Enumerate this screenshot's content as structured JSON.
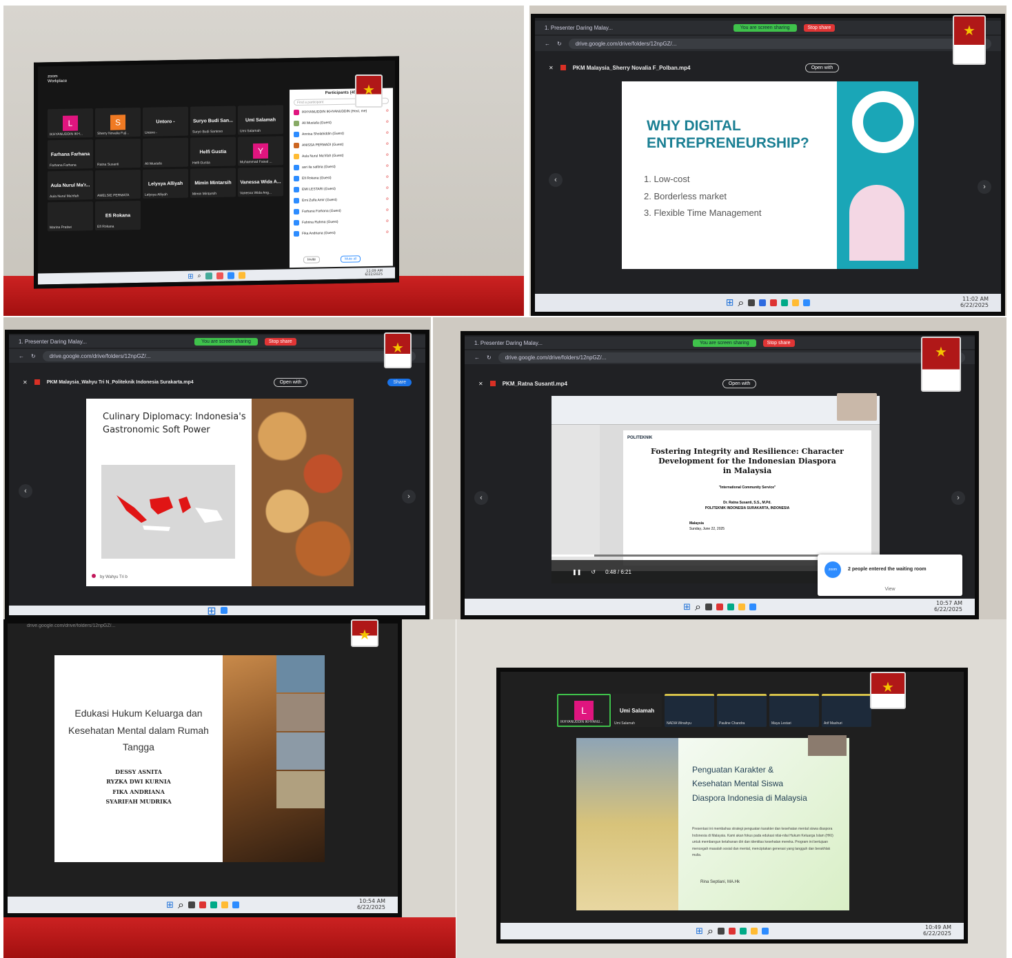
{
  "photo1": {
    "app_label": "zoom\nWorkplace",
    "participants_header": "Participants (45)",
    "find_placeholder": "Find a participant",
    "tiles": [
      {
        "label": "L",
        "name": "IKHYANUDDIN IKH..."
      },
      {
        "label": "S",
        "name": "Sherry Novalia Fuji..."
      },
      {
        "label": "Untoro -",
        "name": "Untoro -"
      },
      {
        "label": "Suryo Budi San...",
        "name": "Suryo Budi Santoso"
      },
      {
        "label": "Umi Salamah",
        "name": "Umi Salamah"
      },
      {
        "label": "Farhana Farhana",
        "name": "Farhana Farhana"
      },
      {
        "label": "",
        "name": "Ratna Susanti"
      },
      {
        "label": "",
        "name": "Ali Mustafa"
      },
      {
        "label": "Helfi Gustia",
        "name": "Helfi Gustia"
      },
      {
        "label": "Y",
        "name": "Muhammad Faisal ..."
      },
      {
        "label": "Aula Nurul Ma'r...",
        "name": "Aula Nurul Ma'rifah"
      },
      {
        "label": "",
        "name": "AMELSIE PERMATA"
      },
      {
        "label": "Lelysya Alliyah",
        "name": "Lelysya Alliyah"
      },
      {
        "label": "Mimin Mintarsih",
        "name": "Mimin Mintarsih"
      },
      {
        "label": "Vanessa Wida A...",
        "name": "Vanessa Wida Ang..."
      },
      {
        "label": "",
        "name": "Marina Pratiwi"
      },
      {
        "label": "Efi Rokana",
        "name": "Efi Rokana"
      }
    ],
    "participants": [
      "IKHYANUDDIN IKHYANUDDIN (Host, me)",
      "Ali Mustafa (Guest)",
      "Annisa Sholahiddin (Guest)",
      "ANISSA PERMADI (Guest)",
      "Aula Nurul Ma'rifah (Guest)",
      "asri ila safitria (Guest)",
      "Efi Rokana (Guest)",
      "EMI LESTARI (Guest)",
      "Erni Zulfa Amir (Guest)",
      "Farhana Farhana (Guest)",
      "Fahrina Rahma (Guest)",
      "Fika Andriana (Guest)"
    ],
    "invite_btn": "Invite",
    "mute_btn": "Mute all",
    "clock": "11:09 AM\n6/22/2025"
  },
  "photo2": {
    "tab_title": "1. Presenter Daring Malay...",
    "sharing_text": "You are screen sharing",
    "stop_share": "Stop share",
    "url": "drive.google.com/drive/folders/12npGZ/...",
    "file_name": "PKM Malaysia_Sherry Novalia F_Polban.mp4",
    "open_with": "Open with",
    "slide_title": "WHY DIGITAL\nENTREPRENEURSHIP?",
    "points": [
      "1. Low-cost",
      "2. Borderless market",
      "3. Flexible Time Management"
    ],
    "clock": "11:02 AM\n6/22/2025"
  },
  "photo3": {
    "tab_title": "1. Presenter Daring Malay...",
    "sharing_text": "You are screen sharing",
    "stop_share": "Stop share",
    "url": "drive.google.com/drive/folders/12npGZ/...",
    "file_name": "PKM Malaysia_Wahyu Tri N_Politeknik Indonesia Surakarta.mp4",
    "open_with": "Open with",
    "share_btn": "Share",
    "slide_title": "Culinary Diplomacy: Indonesia's\nGastronomic Soft Power",
    "byline": "by Wahyu Tri b"
  },
  "photo4": {
    "tab_title": "1. Presenter Daring Malay...",
    "sharing_text": "You are screen sharing",
    "stop_share": "Stop share",
    "url": "drive.google.com/drive/folders/12npGZ/...",
    "file_name": "PKM_Ratna SusantI.mp4",
    "open_with": "Open with",
    "logo_text": "POLITEKNIK",
    "slide_title": "Fostering Integrity and Resilience: Character\nDevelopment for the Indonesian Diaspora\nin Malaysia",
    "subtitle": "\"International Community Service\"",
    "author": "Dr. Ratna Susanti, S.S., M.Pd.",
    "institution": "POLITEKNIK INDONESIA SURAKARTA, INDONESIA",
    "place": "Malaysia",
    "date_line": "Sunday, June 22, 2025",
    "video_time": "0:48 / 6:21",
    "waiting_text": "2 people entered the waiting room",
    "waiting_view": "View",
    "clock": "10:57 AM\n6/22/2025"
  },
  "photo5": {
    "url_fragment": "drive.google.com/drive/folders/12npGZ/...",
    "slide_title": "Edukasi Hukum Keluarga dan\nKesehatan Mental dalam Rumah\nTangga",
    "authors": [
      "DESSY ASNITA",
      "RYZKA DWI KURNIA",
      "FIKA ANDRIANA",
      "SYARIFAH MUDRIKA"
    ],
    "clock": "10:54 AM\n6/22/2025"
  },
  "photo6": {
    "host_letter": "L",
    "host_name": "IKHYANUDDIN IKHYANU...",
    "speaker_name": "Umi Salamah",
    "speaker_tag": "Umi Salamah",
    "strip_names": [
      "NADIA Winahyu",
      "Pauline Chandra",
      "Maya Lestari",
      "Arif Mashuri"
    ],
    "slide_title": "Penguatan Karakter &\nKesehatan Mental Siswa\nDiaspora Indonesia di Malaysia",
    "body": "Presentasi ini membahas strategi penguatan karakter dan kesehatan mental siswa diaspora Indonesia di Malaysia. Kami akan fokus pada edukasi nilai-nilai Hukum Keluarga Islam (HKI) untuk membangun ketahanan diri dan identitas kesehatan mereka. Program ini bertujuan mencegah masalah sosial dan mental, menciptakan generasi yang tangguh dan berakhlak mulia.",
    "author": "Rina Septiani, MA.Hk",
    "clock": "10:49 AM\n6/22/2025"
  },
  "colors": {
    "zoom_pink": "#e0157f",
    "zoom_orange": "#f07a23",
    "slide_teal": "#1aa6b7",
    "share_green": "#3fc24b",
    "stop_red": "#e03535",
    "flag_red": "#c22"
  }
}
